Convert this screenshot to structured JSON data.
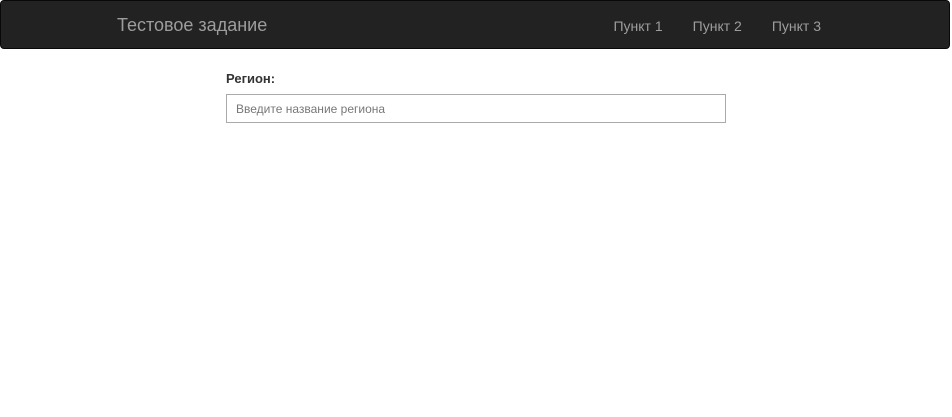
{
  "navbar": {
    "brand": "Тестовое задание",
    "items": [
      {
        "label": "Пункт 1"
      },
      {
        "label": "Пункт 2"
      },
      {
        "label": "Пункт 3"
      }
    ]
  },
  "form": {
    "region_label": "Регион:",
    "region_placeholder": "Введите название региона",
    "region_value": ""
  },
  "colors": {
    "navbar_bg": "#222222",
    "nav_text": "#9d9d9d"
  }
}
